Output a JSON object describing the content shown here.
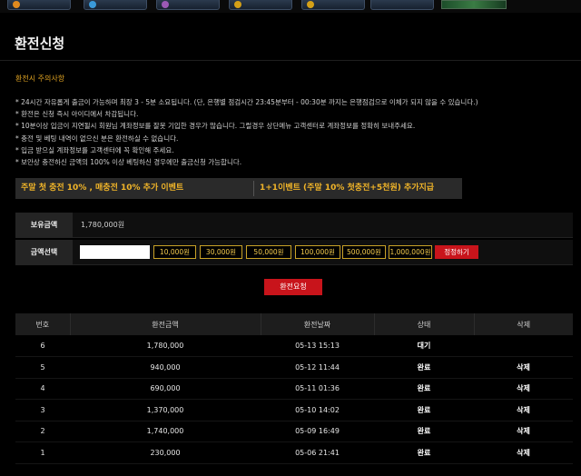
{
  "page": {
    "title": "환전신청"
  },
  "notice": {
    "heading": "환전시 주의사항",
    "items": [
      "* 24시간 자유롭게 출금이 가능하며 최장 3 - 5분 소요됩니다. (단, 은행별 점검시간 23:45분부터 - 00:30분 까지는 은행점검으로 이체가 되지 않을 수 있습니다.)",
      "* 환전은 신청 즉시 아이디에서 차감됩니다.",
      "* 10분이상 입금이 지연될시 회원님 계좌정보를 잘못 기입한 경우가 많습니다. 그럴경우 상단메뉴 고객센터로 계좌정보를 정확히 보내주세요.",
      "* 충전 및 베팅 내역이 없으신 분은 환전하실 수 없습니다.",
      "* 입금 받으실 계좌정보를 고객센터에 꼭 확인해 주세요.",
      "* 보안상 충전하신 금액의 100% 이상 베팅하신 경우에만 출금신청 가능합니다."
    ]
  },
  "events": {
    "left": "주말 첫 충전 10% , 매충전 10% 추가 이벤트",
    "right": "1+1이벤트 (주말 10% 첫충전+5천원) 추가지급"
  },
  "balance": {
    "label": "보유금액",
    "value": "1,780,000원"
  },
  "amount_select": {
    "label": "금액선택",
    "input_value": "",
    "buttons": [
      "10,000원",
      "30,000원",
      "50,000원",
      "100,000원",
      "500,000원",
      "1,000,000원"
    ],
    "reset_label": "정정하기"
  },
  "submit_label": "환전요청",
  "history": {
    "headers": [
      "번호",
      "환전금액",
      "환전날짜",
      "상태",
      "삭제"
    ],
    "rows": [
      {
        "no": "6",
        "amount": "1,780,000",
        "date": "05-13 15:13",
        "status": "대기",
        "delete": ""
      },
      {
        "no": "5",
        "amount": "940,000",
        "date": "05-12 11:44",
        "status": "완료",
        "delete": "삭제"
      },
      {
        "no": "4",
        "amount": "690,000",
        "date": "05-11 01:36",
        "status": "완료",
        "delete": "삭제"
      },
      {
        "no": "3",
        "amount": "1,370,000",
        "date": "05-10 14:02",
        "status": "완료",
        "delete": "삭제"
      },
      {
        "no": "2",
        "amount": "1,740,000",
        "date": "05-09 16:49",
        "status": "완료",
        "delete": "삭제"
      },
      {
        "no": "1",
        "amount": "230,000",
        "date": "05-06 21:41",
        "status": "완료",
        "delete": "삭제"
      }
    ]
  },
  "colors": {
    "accent_red": "#c8141b",
    "accent_gold": "#f0b429",
    "notice_orange": "#e0a322"
  },
  "icons": [
    "nav-icon"
  ]
}
